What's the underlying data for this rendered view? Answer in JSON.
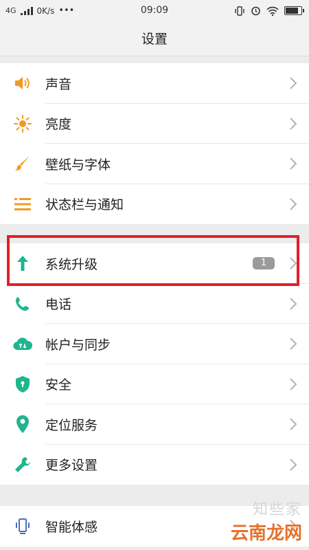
{
  "status_bar": {
    "network": "4G",
    "speed": "0K/s",
    "dots": "•••",
    "time": "09:09"
  },
  "title": "设置",
  "groups": [
    {
      "items": [
        {
          "label": "声音",
          "icon": "speaker-icon"
        },
        {
          "label": "亮度",
          "icon": "brightness-icon"
        },
        {
          "label": "壁纸与字体",
          "icon": "brush-icon"
        },
        {
          "label": "状态栏与通知",
          "icon": "list-icon"
        }
      ]
    },
    {
      "items": [
        {
          "label": "系统升级",
          "icon": "arrow-up-icon",
          "badge": "1"
        },
        {
          "label": "电话",
          "icon": "phone-icon"
        },
        {
          "label": "帐户与同步",
          "icon": "cloud-sync-icon"
        },
        {
          "label": "安全",
          "icon": "shield-icon"
        },
        {
          "label": "定位服务",
          "icon": "location-pin-icon"
        },
        {
          "label": "更多设置",
          "icon": "wrench-icon"
        }
      ]
    },
    {
      "items": [
        {
          "label": "智能体感",
          "icon": "phone-motion-icon"
        }
      ]
    }
  ],
  "watermark": {
    "top": "知些家",
    "main": "云南龙网"
  },
  "colors": {
    "orange": "#f29a1f",
    "teal": "#1fb58f",
    "blue": "#4a6fbf",
    "highlight_red": "#e12028"
  }
}
